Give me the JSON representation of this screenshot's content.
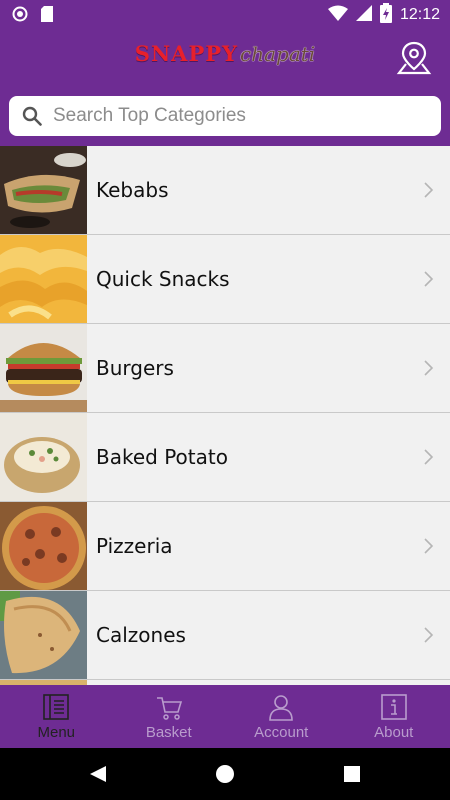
{
  "status_bar": {
    "time": "12:12"
  },
  "header": {
    "logo": {
      "part1": "SNAPPY",
      "part2": "chapati"
    },
    "search": {
      "placeholder": "Search Top Categories",
      "value": ""
    }
  },
  "categories": [
    {
      "label": "Kebabs"
    },
    {
      "label": "Quick Snacks"
    },
    {
      "label": "Burgers"
    },
    {
      "label": "Baked Potato"
    },
    {
      "label": "Pizzeria"
    },
    {
      "label": "Calzones"
    }
  ],
  "tabs": [
    {
      "label": "Menu",
      "icon": "menu-icon",
      "active": true
    },
    {
      "label": "Basket",
      "icon": "cart-icon",
      "active": false
    },
    {
      "label": "Account",
      "icon": "user-icon",
      "active": false
    },
    {
      "label": "About",
      "icon": "info-icon",
      "active": false
    }
  ],
  "colors": {
    "brand_purple": "#6e2c93",
    "logo_red": "#e8202b",
    "list_background": "#f1f1f1",
    "tab_inactive": "#b99ccd",
    "tab_active": "#222222"
  }
}
